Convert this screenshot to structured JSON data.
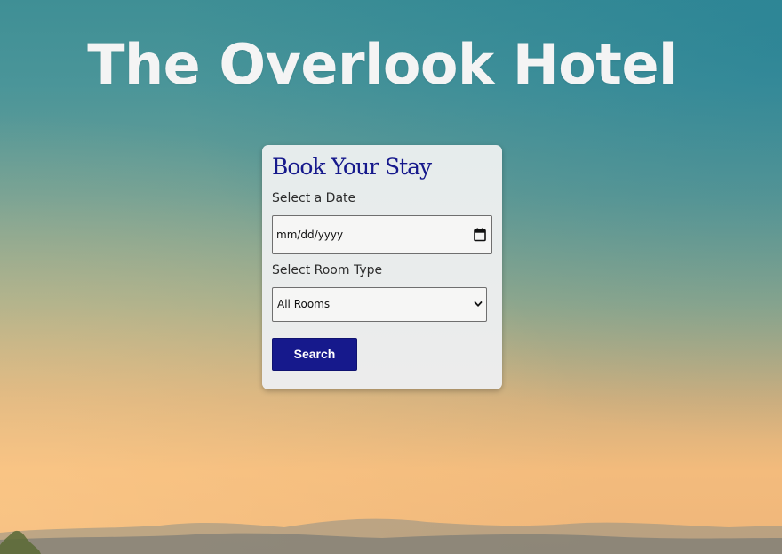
{
  "page": {
    "title": "The Overlook Hotel"
  },
  "booking": {
    "heading": "Book Your Stay",
    "date_label": "Select a Date",
    "date_placeholder": "mm/dd/yyyy",
    "room_label": "Select Room Type",
    "room_selected": "All Rooms",
    "search_label": "Search"
  },
  "icons": {
    "date": "calendar-icon",
    "select": "chevron-down-icon"
  },
  "colors": {
    "accent": "#16198c",
    "title_text": "#f4f4f4",
    "card_bg": "#ececec"
  }
}
